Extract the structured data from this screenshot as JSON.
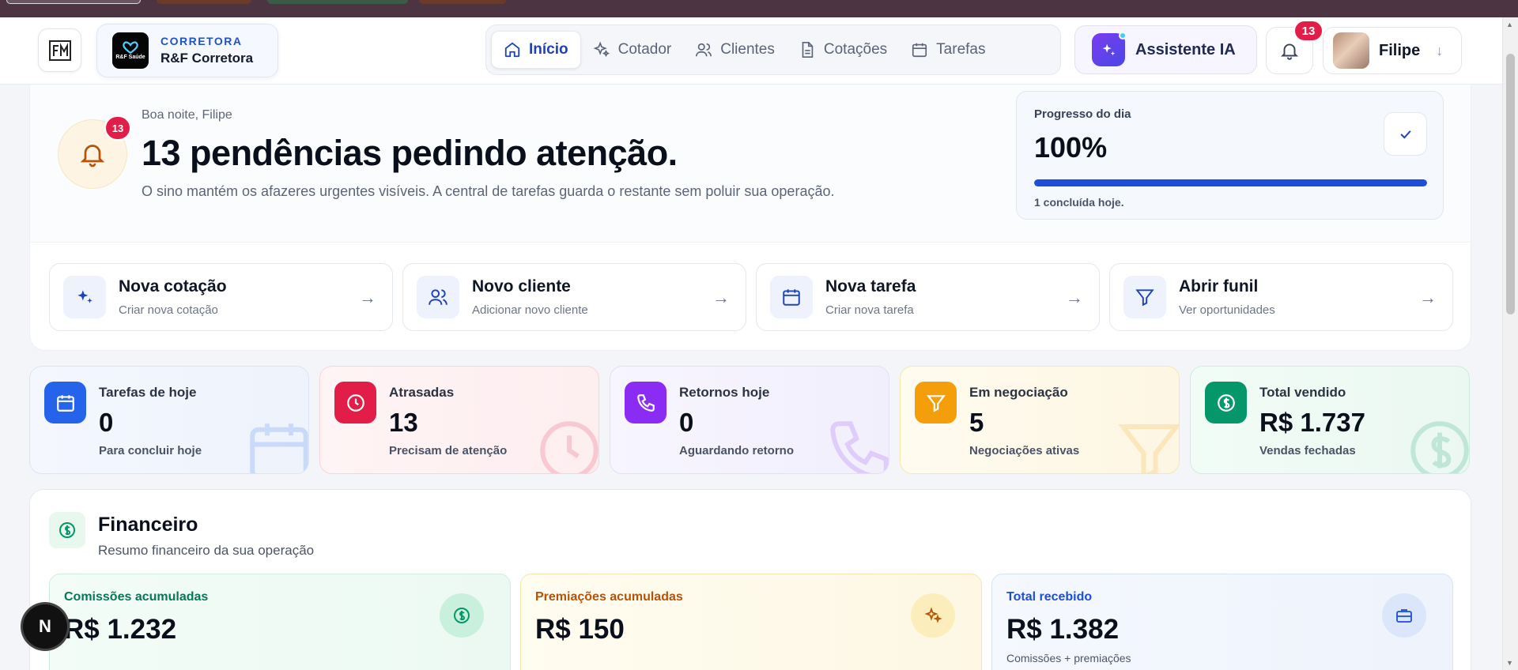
{
  "colors": {
    "accent": "#1e43b8",
    "badge": "#e11d48",
    "topbar": "#4c3442"
  },
  "header": {
    "logo_icon": "fm-logo-icon",
    "org_kicker": "CORRETORA",
    "org_name": "R&F Corretora",
    "org_logo_text": "R&F Saúde",
    "tabs": [
      {
        "label": "Início",
        "icon": "home-icon",
        "active": true
      },
      {
        "label": "Cotador",
        "icon": "sparkles-icon"
      },
      {
        "label": "Clientes",
        "icon": "users-icon"
      },
      {
        "label": "Cotações",
        "icon": "document-icon"
      },
      {
        "label": "Tarefas",
        "icon": "calendar-icon"
      }
    ],
    "ai_label": "Assistente IA",
    "notifications_count": "13",
    "user_name": "Filipe"
  },
  "hero": {
    "badge": "13",
    "greeting": "Boa noite, Filipe",
    "headline": "13 pendências pedindo atenção.",
    "subline": "O sino mantém os afazeres urgentes visíveis. A central de tarefas guarda o restante sem poluir sua operação.",
    "progress": {
      "title": "Progresso do dia",
      "value": "100%",
      "fraction": 1.0,
      "note": "1 concluída hoje."
    }
  },
  "quick_actions": [
    {
      "title": "Nova cotação",
      "desc": "Criar nova cotação",
      "icon": "sparkles-icon"
    },
    {
      "title": "Novo cliente",
      "desc": "Adicionar novo cliente",
      "icon": "users-icon"
    },
    {
      "title": "Nova tarefa",
      "desc": "Criar nova tarefa",
      "icon": "calendar-icon"
    },
    {
      "title": "Abrir funil",
      "desc": "Ver oportunidades",
      "icon": "funnel-icon"
    }
  ],
  "stats": [
    {
      "label": "Tarefas de hoje",
      "value": "0",
      "desc": "Para concluir hoje",
      "icon": "calendar-icon",
      "color": "#2563eb"
    },
    {
      "label": "Atrasadas",
      "value": "13",
      "desc": "Precisam de atenção",
      "icon": "clock-icon",
      "color": "#e11d48"
    },
    {
      "label": "Retornos hoje",
      "value": "0",
      "desc": "Aguardando retorno",
      "icon": "phone-icon",
      "color": "#8b2cf5"
    },
    {
      "label": "Em negociação",
      "value": "5",
      "desc": "Negociações ativas",
      "icon": "funnel-icon",
      "color": "#f59e0b"
    },
    {
      "label": "Total vendido",
      "value": "R$ 1.737",
      "desc": "Vendas fechadas",
      "icon": "dollar-icon",
      "color": "#059669"
    }
  ],
  "finance": {
    "title": "Financeiro",
    "subtitle": "Resumo financeiro da sua operação",
    "cards": [
      {
        "label": "Comissões acumuladas",
        "value": "R$ 1.232",
        "note": "",
        "icon": "dollar-icon"
      },
      {
        "label": "Premiações acumuladas",
        "value": "R$ 150",
        "note": "",
        "icon": "sparkles-icon"
      },
      {
        "label": "Total recebido",
        "value": "R$ 1.382",
        "note": "Comissões + premiações",
        "icon": "briefcase-icon"
      }
    ]
  },
  "floating_button": "N"
}
